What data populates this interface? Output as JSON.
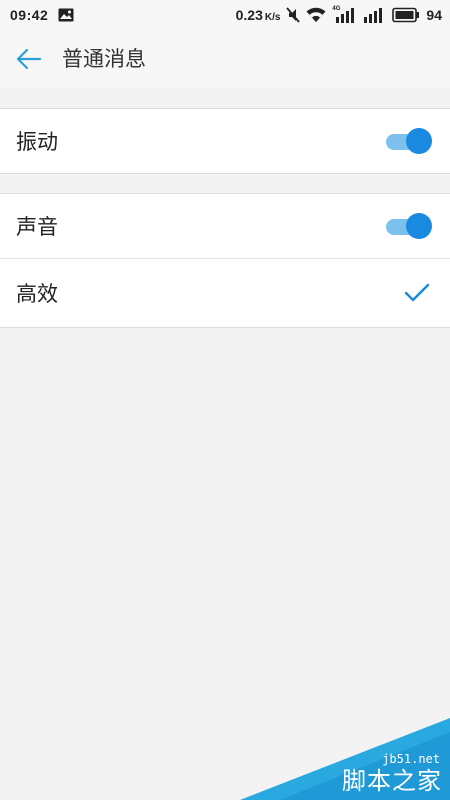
{
  "status_bar": {
    "time": "09:42",
    "speed": "0.23",
    "speed_unit": "K/s",
    "network_type": "4G",
    "battery": "94",
    "icons": [
      "image-notification-icon",
      "mute-icon",
      "wifi-icon",
      "signal-4g-icon",
      "signal-icon",
      "battery-icon"
    ]
  },
  "header": {
    "title": "普通消息",
    "back_icon": "arrow-left-icon"
  },
  "settings": {
    "vibration": {
      "label": "振动",
      "enabled": true
    },
    "sound": {
      "label": "声音",
      "enabled": true
    },
    "efficient": {
      "label": "高效",
      "selected": true
    }
  },
  "watermark": {
    "url": "jb51.net",
    "name": "脚本之家"
  },
  "colors": {
    "accent": "#1a8ae0",
    "track": "#7cc0ee",
    "background": "#f3f3f3",
    "watermark": "#2aa8e0"
  }
}
